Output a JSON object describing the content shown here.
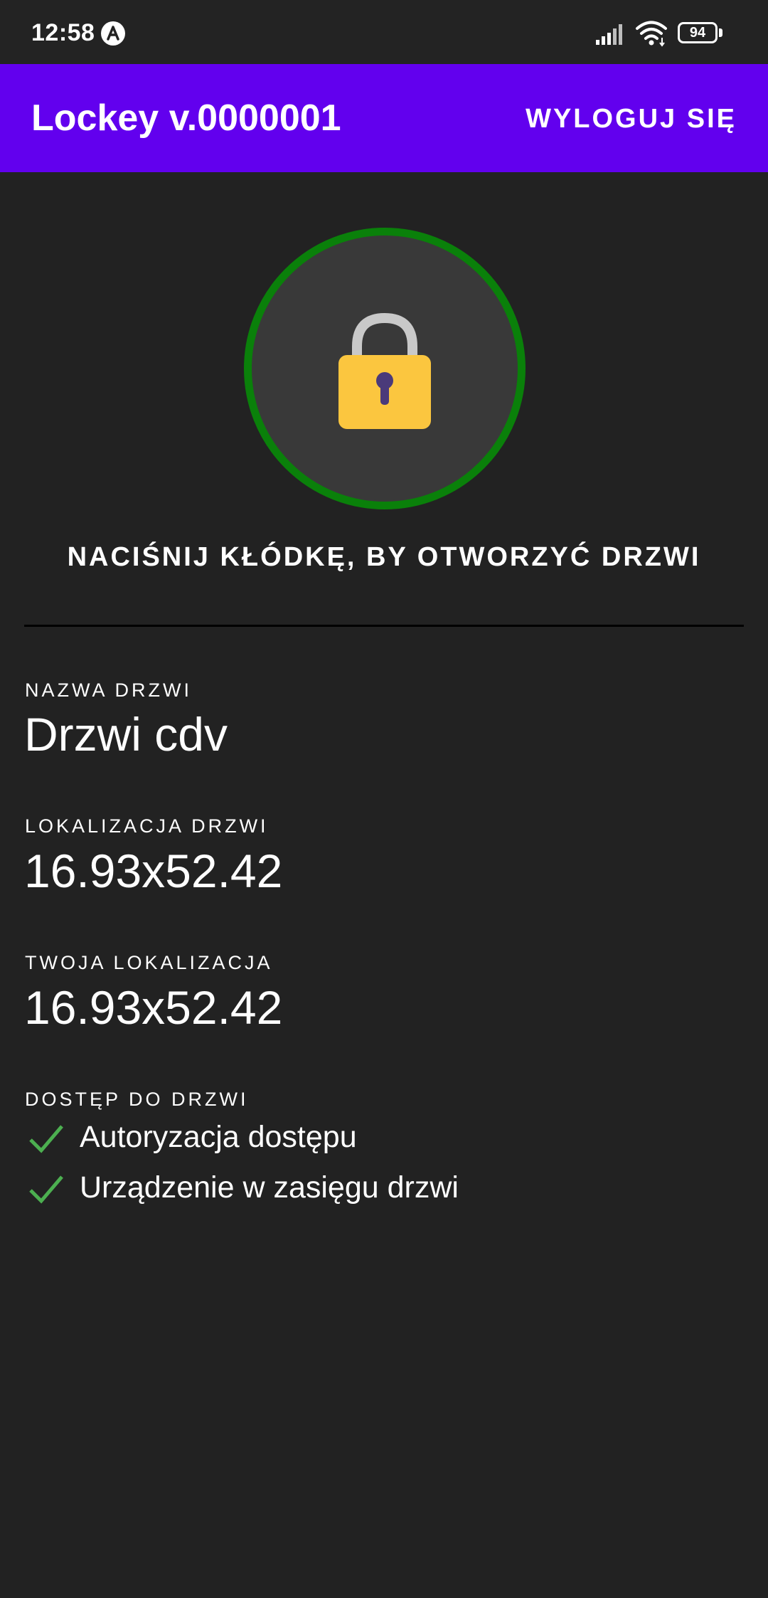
{
  "status_bar": {
    "time": "12:58",
    "battery_level": "94",
    "icons": [
      "app-notification-icon",
      "signal-icon",
      "wifi-icon",
      "battery-icon"
    ]
  },
  "app_bar": {
    "title": "Lockey v.0000001",
    "logout_label": "WYLOGUJ SIĘ",
    "background_color": "#6200ee"
  },
  "lock": {
    "icon": "padlock-icon",
    "ring_color": "#0a800a",
    "hint": "NACIŚNIJ KŁÓDKĘ, BY OTWORZYĆ DRZWI"
  },
  "details": {
    "door_name_label": "NAZWA DRZWI",
    "door_name": "Drzwi cdv",
    "door_location_label": "LOKALIZACJA DRZWI",
    "door_location": "16.93x52.42",
    "your_location_label": "TWOJA LOKALIZACJA",
    "your_location": "16.93x52.42"
  },
  "access": {
    "label": "DOSTĘP DO DRZWI",
    "items": [
      {
        "text": "Autoryzacja dostępu",
        "icon": "check-icon",
        "color": "#4caf50"
      },
      {
        "text": "Urządzenie w zasięgu drzwi",
        "icon": "check-icon",
        "color": "#4caf50"
      }
    ]
  }
}
